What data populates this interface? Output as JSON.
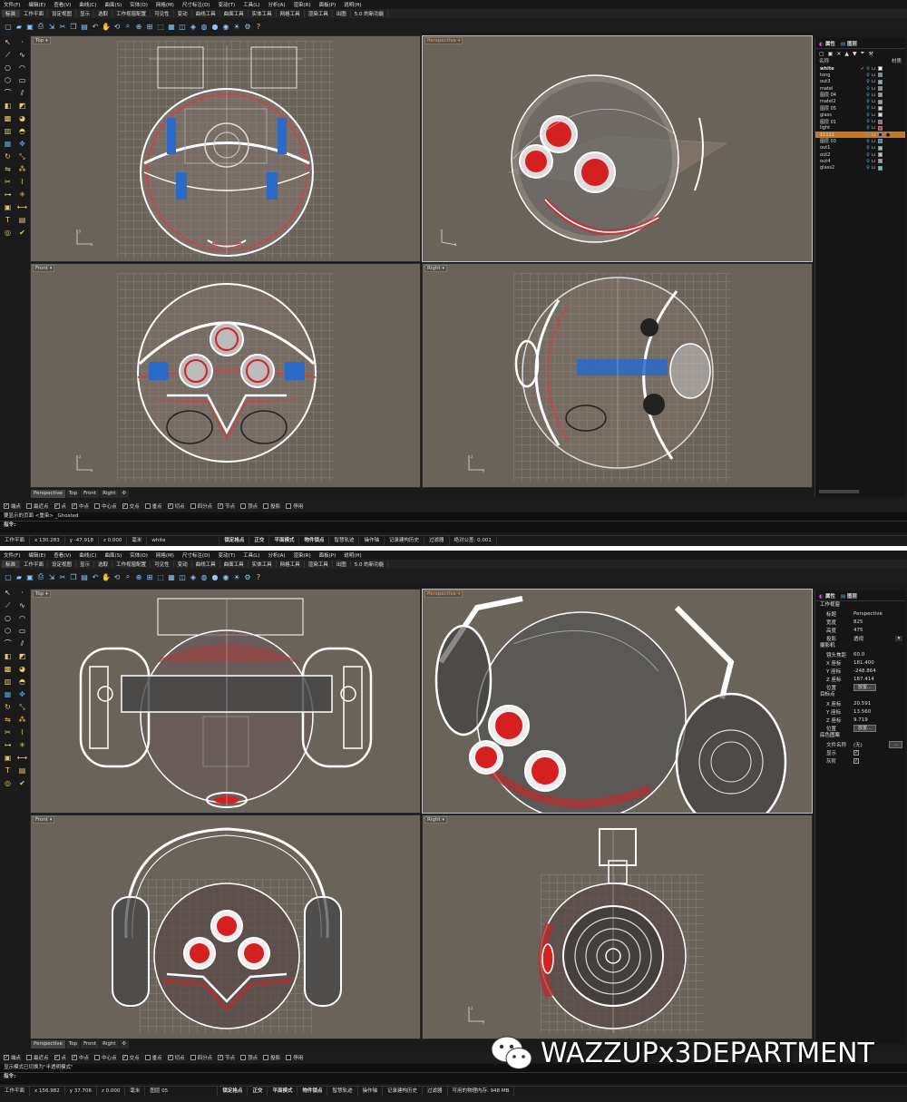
{
  "menu": [
    "文件(F)",
    "编辑(E)",
    "查看(V)",
    "曲线(C)",
    "曲面(S)",
    "实体(O)",
    "网格(M)",
    "尺寸标注(D)",
    "变动(T)",
    "工具(L)",
    "分析(A)",
    "渲染(R)",
    "面板(P)",
    "说明(H)"
  ],
  "tabs": [
    "标准",
    "工作平面",
    "设定视图",
    "显示",
    "选取",
    "工作视窗配置",
    "可见性",
    "变动",
    "曲线工具",
    "曲面工具",
    "实体工具",
    "网格工具",
    "渲染工具",
    "出图",
    "5.0 的新功能"
  ],
  "toolbar_icons": [
    "new-icon",
    "open-icon",
    "save-icon",
    "print-icon",
    "import-icon",
    "cut-icon",
    "copy-icon",
    "paste-icon",
    "undo-icon",
    "pan-icon",
    "rotate-icon",
    "zoom-icon",
    "zoom-window-icon",
    "zoom-extents-icon",
    "select-icon",
    "grid-icon",
    "cplane-icon",
    "layer-icon",
    "color-icon",
    "material-icon",
    "render-icon",
    "light-icon",
    "settings-icon",
    "help-icon"
  ],
  "viewport_names": {
    "top": "Top",
    "perspective": "Perspective",
    "front": "Front",
    "right": "Right"
  },
  "viewport_tabs": [
    "Perspective",
    "Top",
    "Front",
    "Right"
  ],
  "snaps": [
    {
      "label": "端点",
      "checked": true
    },
    {
      "label": "最近点",
      "checked": false
    },
    {
      "label": "点",
      "checked": true
    },
    {
      "label": "中点",
      "checked": true
    },
    {
      "label": "中心点",
      "checked": false
    },
    {
      "label": "交点",
      "checked": true
    },
    {
      "label": "垂点",
      "checked": false
    },
    {
      "label": "切点",
      "checked": true
    },
    {
      "label": "四分点",
      "checked": false
    },
    {
      "label": "节点",
      "checked": true
    },
    {
      "label": "顶点",
      "checked": false
    },
    {
      "label": "投影",
      "checked": false
    },
    {
      "label": "停用",
      "checked": false
    }
  ],
  "shot1": {
    "cmd_history": "要显示的页面 <重染> _Ghosted",
    "cmd_prompt": "指令:",
    "status": {
      "cplane": "工作平面",
      "x": "x 130.283",
      "y": "y -47.918",
      "z": "z 0.000",
      "unit": "毫米",
      "layer": "white",
      "grid_snap": "锁定格点",
      "ortho": "正交",
      "planar": "平面模式",
      "osnap": "物件锁点",
      "smart": "智慧轨迹",
      "gumball": "操作轴",
      "history": "记录建构历史",
      "filter": "过滤器",
      "tolerance": "绝对公差: 0.001"
    },
    "panel_tabs": [
      "属性",
      "图层"
    ],
    "layer_header": {
      "name": "名称",
      "material": "材质"
    },
    "layers": [
      {
        "name": "white",
        "color": "#ffffff",
        "current": true
      },
      {
        "name": "tong",
        "color": "#3aa0e0"
      },
      {
        "name": "out3",
        "color": "#60c0c0"
      },
      {
        "name": "matel",
        "color": "#909090"
      },
      {
        "name": "图层 04",
        "color": "#a0a0a0"
      },
      {
        "name": "matel2",
        "color": "#b0a080"
      },
      {
        "name": "图层 05",
        "color": "#d0d0d0"
      },
      {
        "name": "glass",
        "color": "#e0e0e0"
      },
      {
        "name": "图层 01",
        "color": "#e040a0"
      },
      {
        "name": "light",
        "color": "#e03030"
      },
      {
        "name": "11111",
        "color": "#202020",
        "selected": true
      },
      {
        "name": "图层 03",
        "color": "#3080d0"
      },
      {
        "name": "out1",
        "color": "#70d0e0"
      },
      {
        "name": "out2",
        "color": "#c0c0c0"
      },
      {
        "name": "out4",
        "color": "#a0a0a0"
      },
      {
        "name": "glass2",
        "color": "#40d0e0"
      }
    ]
  },
  "shot2": {
    "cmd_history": "显示模式已切换为\"半透明模式\"",
    "cmd_prompt": "指令:",
    "status": {
      "cplane": "工作平面",
      "x": "x 156.982",
      "y": "y 37.706",
      "z": "z 0.000",
      "unit": "毫米",
      "layer": "图层 05",
      "grid_snap": "锁定格点",
      "ortho": "正交",
      "planar": "平面模式",
      "osnap": "物件锁点",
      "smart": "智慧轨迹",
      "gumball": "操作轴",
      "history": "记录建构历史",
      "filter": "过滤器",
      "memory": "可用的物理内存: 948 MB"
    },
    "panel_tabs": [
      "属性",
      "图层"
    ],
    "props": {
      "section_viewport": "工作视窗",
      "title_k": "标题",
      "title_v": "Perspective",
      "width_k": "宽度",
      "width_v": "825",
      "height_k": "高度",
      "height_v": "475",
      "proj_k": "投影",
      "proj_v": "透视",
      "section_camera": "摄影机",
      "lens_k": "镜头焦距",
      "lens_v": "60.0",
      "cx_k": "X 座标",
      "cx_v": "181.400",
      "cy_k": "Y 座标",
      "cy_v": "-248.864",
      "cz_k": "Z 座标",
      "cz_v": "187.414",
      "pos_k": "位置",
      "place_btn": "放置...",
      "section_target": "目标点",
      "tx_k": "X 座标",
      "tx_v": "20.591",
      "ty_k": "Y 座标",
      "ty_v": "13.560",
      "tz_k": "Z 座标",
      "tz_v": "9.719",
      "tpos_k": "位置",
      "tplace_btn": "放置...",
      "section_wallpaper": "底色图案",
      "file_k": "文件名称",
      "file_v": "(无)",
      "browse": "...",
      "show_k": "显示",
      "gray_k": "灰阶"
    }
  },
  "watermark": "WAZZUPx3DEPARTMENT",
  "colors": {
    "viewport": "#6a635a",
    "active_label": "#ff9f2f",
    "selection": "#c8781e",
    "lens_red": "#d42020"
  }
}
